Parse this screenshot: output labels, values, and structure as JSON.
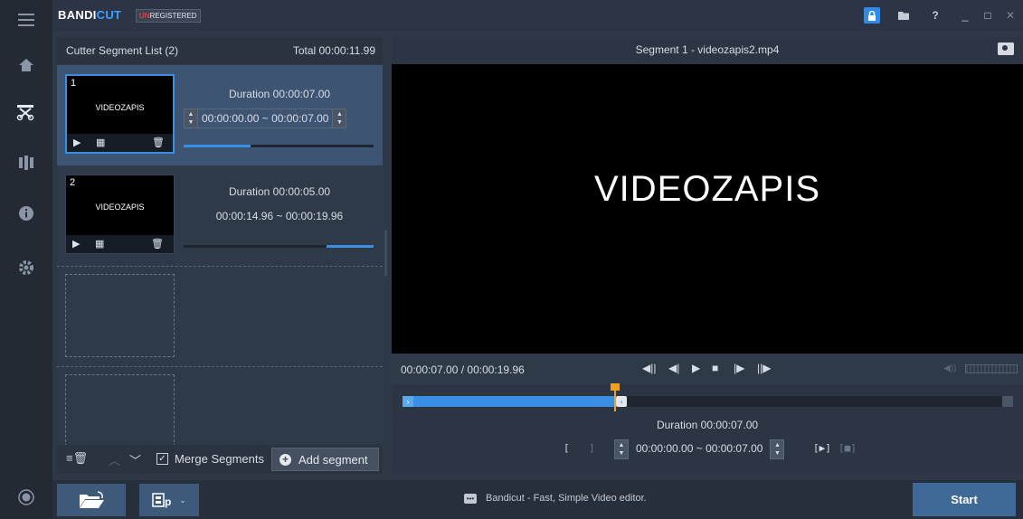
{
  "app": {
    "logo_a": "BANDI",
    "logo_b": "CUT",
    "unreg_a": "UN",
    "unreg_b": "REGISTERED"
  },
  "titlebar": {
    "help_label": "?",
    "minimize_label": "_",
    "maximize_label": "□",
    "close_label": "✕"
  },
  "segments_panel": {
    "title": "Cutter Segment List (2)",
    "total": "Total 00:00:11.99",
    "items": [
      {
        "number": "1",
        "thumb_title": "VIDEOZAPIS",
        "duration": "Duration 00:00:07.00",
        "range": "00:00:00.00 ~ 00:00:07.00",
        "progress": 0.35
      },
      {
        "number": "2",
        "thumb_title": "VIDEOZAPIS",
        "duration": "Duration 00:00:05.00",
        "range": "00:00:14.96 ~ 00:00:19.96",
        "progress": 0.25
      }
    ],
    "merge_label": "Merge Segments",
    "merge_checked": "✓",
    "add_label": "Add segment"
  },
  "preview": {
    "title": "Segment 1 - videozapis2.mp4",
    "video_text": "VIDEOZAPIS",
    "time": "00:00:07.00 / 00:00:19.96"
  },
  "timeline": {
    "selection_end_fraction": 0.35,
    "duration": "Duration 00:00:07.00",
    "range": "00:00:00.00  ~  00:00:07.00"
  },
  "bottom": {
    "status": "Bandicut - Fast, Simple Video editor.",
    "start_label": "Start"
  },
  "colors": {
    "accent": "#3a8ee6",
    "playhead": "#f0a020",
    "unregistered": "#ff4d4d"
  }
}
